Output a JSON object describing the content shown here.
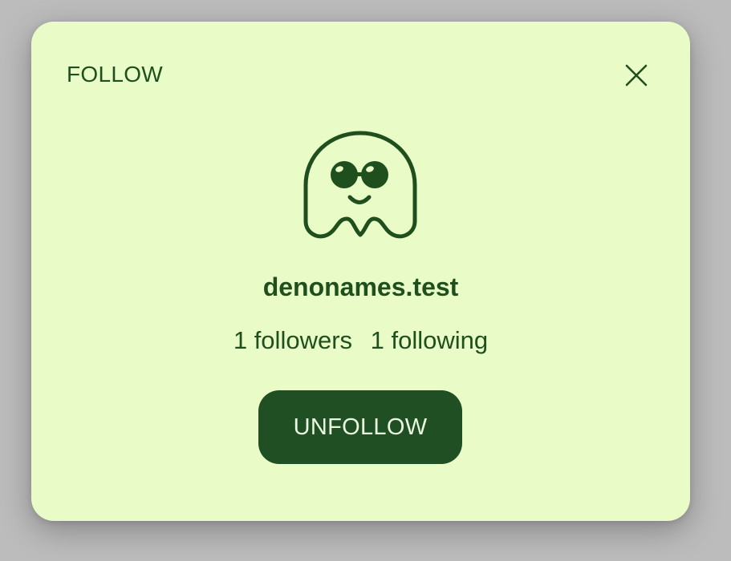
{
  "modal": {
    "title": "FOLLOW",
    "close_icon": "close-icon",
    "avatar_icon": "ghost-sunglasses-icon",
    "username": "denonames.test",
    "stats": {
      "followers_label": "1 followers",
      "following_label": "1 following"
    },
    "unfollow_label": "UNFOLLOW"
  },
  "colors": {
    "backdrop": "#bcbcbc",
    "modal_background": "#e9fbc7",
    "accent": "#1f4f1d",
    "button_text": "#eaf7e1"
  }
}
